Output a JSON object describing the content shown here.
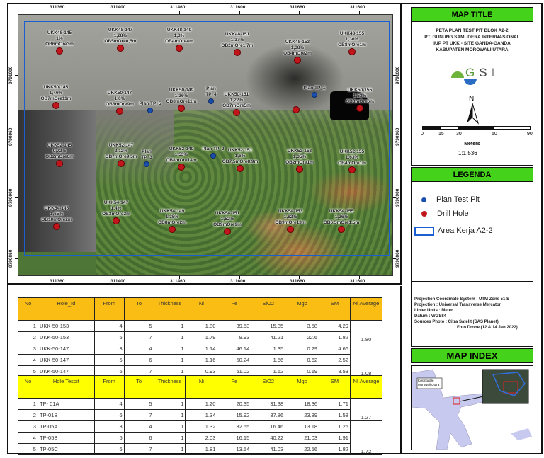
{
  "map": {
    "x_ticks": [
      "311360",
      "311400",
      "311460",
      "311600",
      "311660",
      "311600"
    ],
    "bottom_ticks": [
      "311360",
      "311400",
      "311460",
      "311600",
      "311660",
      "311600"
    ],
    "y_ticks_left": [
      "9791000",
      "9790960",
      "9790900",
      "9790860"
    ],
    "y_ticks_right": [
      "9791000",
      "9790960",
      "9790900",
      "9790860"
    ],
    "drill_holes": [
      {
        "id": "UKK48-145",
        "ni": "1%",
        "ob": "OB6mOre3m"
      },
      {
        "id": "UKK48-147",
        "ni": "1,28%",
        "ob": "OB5mOre0,5m"
      },
      {
        "id": "UKK48-149",
        "ni": "1,3%",
        "ob": "OB4mOre4m"
      },
      {
        "id": "UKK48-151",
        "ni": "1,37%",
        "ob": "OB2mOre1,7m"
      },
      {
        "id": "UKK48-153",
        "ni": "1,38%",
        "ob": "OB4mOre2m"
      },
      {
        "id": "UKK48-155",
        "ni": "1,36%",
        "ob": "OB8mOre1m"
      },
      {
        "id": "UKK50-145",
        "ni": "1,46%",
        "ob": "OB7mOre11m"
      },
      {
        "id": "UKK50-147",
        "ni": "1,6%",
        "ob": "OB8mOre9m"
      },
      {
        "id": "UKK50-149",
        "ni": "1,36%",
        "ob": "OB8mOre11m"
      },
      {
        "id": "UKK50-151",
        "ni": "1,22%",
        "ob": "OB7mOre5m"
      },
      {
        "id": "",
        "ni": "",
        "ob": ""
      },
      {
        "id": "UKK50-155",
        "ni": "1,53%",
        "ob": "OB3mOre6m"
      },
      {
        "id": "UKK52-145",
        "ni": "0,72%",
        "ob": "OB2mOre6m"
      },
      {
        "id": "UKK52-147",
        "ni": "2,12%",
        "ob": "OB7mOre9,5m"
      },
      {
        "id": "UKK52-149",
        "ni": "1,53%",
        "ob": "OB8mOre14m"
      },
      {
        "id": "UKK52-151",
        "ni": "1,6%",
        "ob": "OB7,5mOre8,9m"
      },
      {
        "id": "UKK52-153",
        "ni": "1,35%",
        "ob": "OB2mOre1m"
      },
      {
        "id": "UKK52-155",
        "ni": "1,63%",
        "ob": "OB4mOre1m"
      },
      {
        "id": "UKK54-145",
        "ni": "1,65%",
        "ob": "OB10mOre2m"
      },
      {
        "id": "UKK54-147",
        "ni": "1,4%",
        "ob": "OB3mOre2m"
      },
      {
        "id": "UKK54-149",
        "ni": "1,35%",
        "ob": "OB8mOre2m"
      },
      {
        "id": "UKK54-151",
        "ni": "1,52%",
        "ob": "OB9mOre9m"
      },
      {
        "id": "UKK54-153",
        "ni": "1,82%",
        "ob": "OB9mOre13m"
      },
      {
        "id": "UKK54-155",
        "ni": "1,36%",
        "ob": "OB6,5mOre1,5m"
      }
    ],
    "test_pits": [
      {
        "label": "Plan TP_5"
      },
      {
        "label": "Plan TP_4"
      },
      {
        "label": "Plan TP_1"
      },
      {
        "label": "Plan TP_3"
      },
      {
        "label": "Plan TP_2"
      }
    ],
    "colors": {
      "drill_hole": "#c0151b",
      "test_pit": "#1a4fb0",
      "work_area": "#1a5fd0"
    }
  },
  "table1": {
    "headers": [
      "No",
      "Hole_Id",
      "From",
      "To",
      "Thickness",
      "Ni",
      "Fe",
      "SiO2",
      "Mgo",
      "SM",
      "Ni Average"
    ],
    "rows": [
      [
        "1",
        "UKK-50-153",
        "4",
        "5",
        "1",
        "1.80",
        "39.53",
        "15.35",
        "3.58",
        "4.29"
      ],
      [
        "2",
        "UKK-50-153",
        "6",
        "7",
        "1",
        "1.79",
        "9.93",
        "41.21",
        "22.6",
        "1.82"
      ],
      [
        "3",
        "UKK-50-147",
        "3",
        "4",
        "1",
        "1.14",
        "46.14",
        "1.35",
        "0.29",
        "4.66"
      ],
      [
        "4",
        "UKK-50-147",
        "5",
        "6",
        "1",
        "1.16",
        "50.24",
        "1.56",
        "0.62",
        "2.52"
      ],
      [
        "5",
        "UKK-50-147",
        "6",
        "7",
        "1",
        "0.93",
        "51.02",
        "1.62",
        "0.19",
        "8.53"
      ]
    ],
    "averages": [
      "1.80",
      "1.08"
    ],
    "header_color": "#f9bd13"
  },
  "table2": {
    "headers": [
      "No",
      "Hole Tespit",
      "From",
      "To",
      "Thickness",
      "Ni",
      "Fe",
      "SiO2",
      "Mgo",
      "SM",
      "NI Average"
    ],
    "rows": [
      [
        "1",
        "TP- 01A",
        "4",
        "5",
        "1",
        "1.20",
        "20.35",
        "31.38",
        "18.36",
        "1.71"
      ],
      [
        "2",
        "TP-01B",
        "6",
        "7",
        "1",
        "1.34",
        "15.92",
        "37.86",
        "23.89",
        "1.58"
      ],
      [
        "3",
        "TP-05A",
        "3",
        "4",
        "1",
        "1.32",
        "32.55",
        "16.46",
        "13.18",
        "1.25"
      ],
      [
        "4",
        "TP-05B",
        "5",
        "6",
        "1",
        "2.03",
        "16.15",
        "40.22",
        "21.03",
        "1.91"
      ],
      [
        "5",
        "TP-05C",
        "6",
        "7",
        "1",
        "1.81",
        "13.54",
        "41.03",
        "22.56",
        "1.82"
      ]
    ],
    "averages": [
      "1.27",
      "1.72"
    ],
    "header_color": "#ffff00"
  },
  "panel": {
    "title_header": "MAP TITLE",
    "title_lines": [
      "PETA PLAN TEST PIT BLOK A2-2",
      "PT. GUNUNG SAMUDERA INTERNASIONAL",
      "IUP PT UKK - SITE GANDA-GANDA",
      "KABUPATEN MOROWALI UTARA"
    ],
    "logo_text": "GSI",
    "north": "N",
    "scale_ticks": [
      "0",
      "15",
      "30",
      "60",
      "90"
    ],
    "scale_unit": "Meters",
    "scale_ratio": "1:1,536",
    "legend_header": "LEGENDA",
    "legend": [
      {
        "label": "Plan Test  Pit"
      },
      {
        "label": "Drill Hole"
      },
      {
        "label": "Area Kerja A2-2"
      }
    ],
    "projection": [
      "Projection Coordinate System : UTM Zone 51 S",
      "Projection : Universal Transverse Mercator",
      "Linier Units : Meter",
      "Datum : WGS84",
      "Sources Photo : Citra Satelit (SAS Planet)",
      "Foto  Drone  (12 & 14 Jan 2022)"
    ],
    "index_header": "MAP INDEX",
    "index_label": [
      "Kolonodale",
      "Morowali Utara"
    ],
    "header_color": "#45d21a"
  }
}
